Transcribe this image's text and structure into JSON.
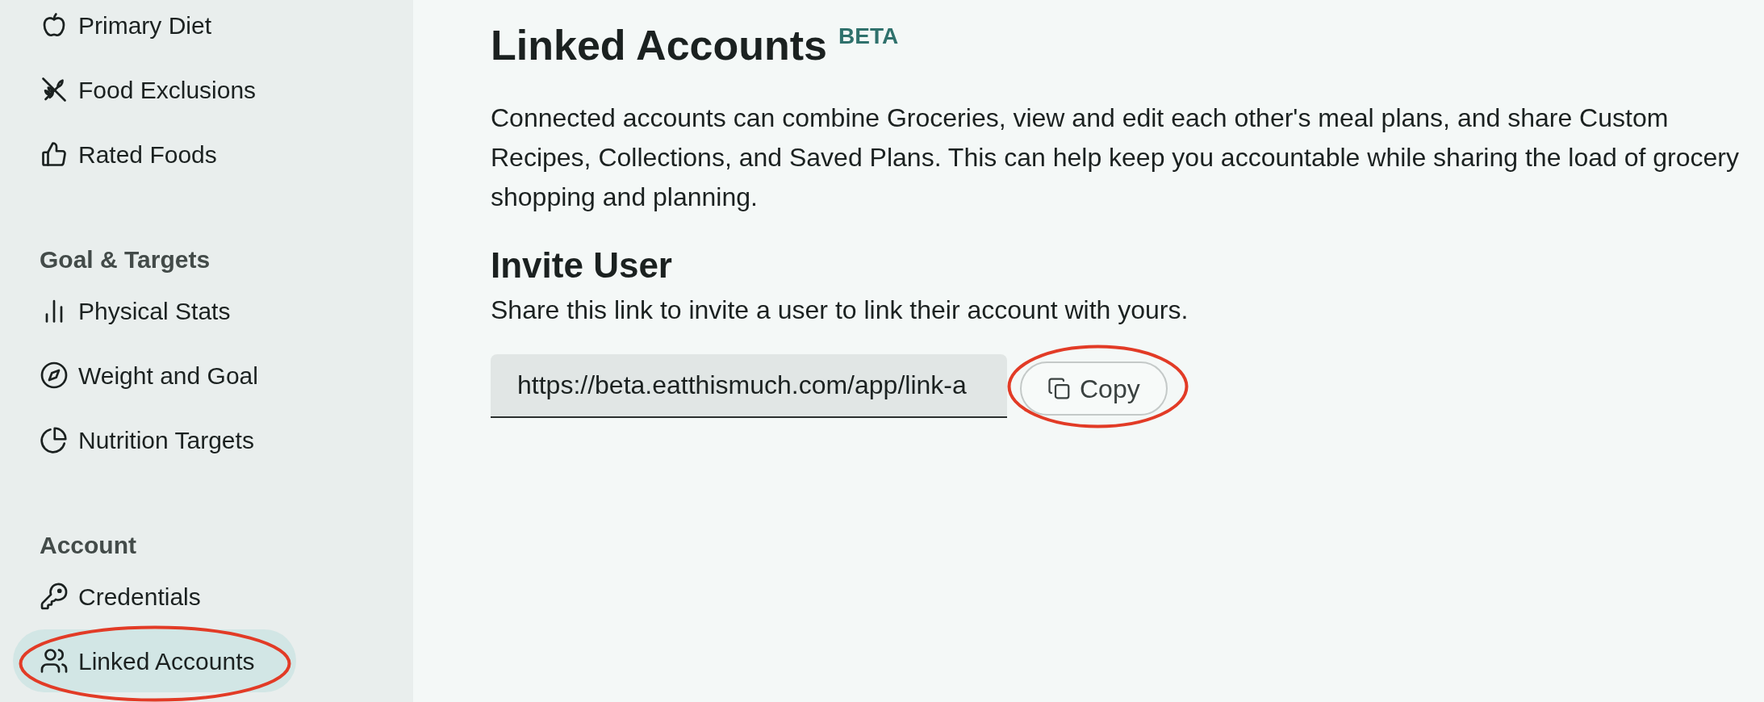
{
  "sidebar": {
    "sections": [
      {
        "items": [
          {
            "label": "Primary Diet",
            "selected": false,
            "circled": false
          },
          {
            "label": "Food Exclusions",
            "selected": false,
            "circled": false
          },
          {
            "label": "Rated Foods",
            "selected": false,
            "circled": false
          }
        ]
      },
      {
        "heading": "Goal & Targets",
        "items": [
          {
            "label": "Physical Stats",
            "selected": false,
            "circled": false
          },
          {
            "label": "Weight and Goal",
            "selected": false,
            "circled": false
          },
          {
            "label": "Nutrition Targets",
            "selected": false,
            "circled": false
          }
        ]
      },
      {
        "heading": "Account",
        "items": [
          {
            "label": "Credentials",
            "selected": false,
            "circled": false
          },
          {
            "label": "Linked Accounts",
            "selected": true,
            "circled": true
          }
        ]
      }
    ]
  },
  "main": {
    "title": "Linked Accounts",
    "badge": "BETA",
    "description": "Connected accounts can combine Groceries, view and edit each other's meal plans, and share Custom Recipes, Collections, and Saved Plans. This can help keep you accountable while sharing the load of grocery shopping and planning.",
    "invite": {
      "heading": "Invite User",
      "description": "Share this link to invite a user to link their account with yours.",
      "link_field": {
        "value": "https://beta.eatthismuch.com/app/link-a"
      },
      "copy_button": {
        "label": "Copy",
        "circled": true
      }
    }
  }
}
